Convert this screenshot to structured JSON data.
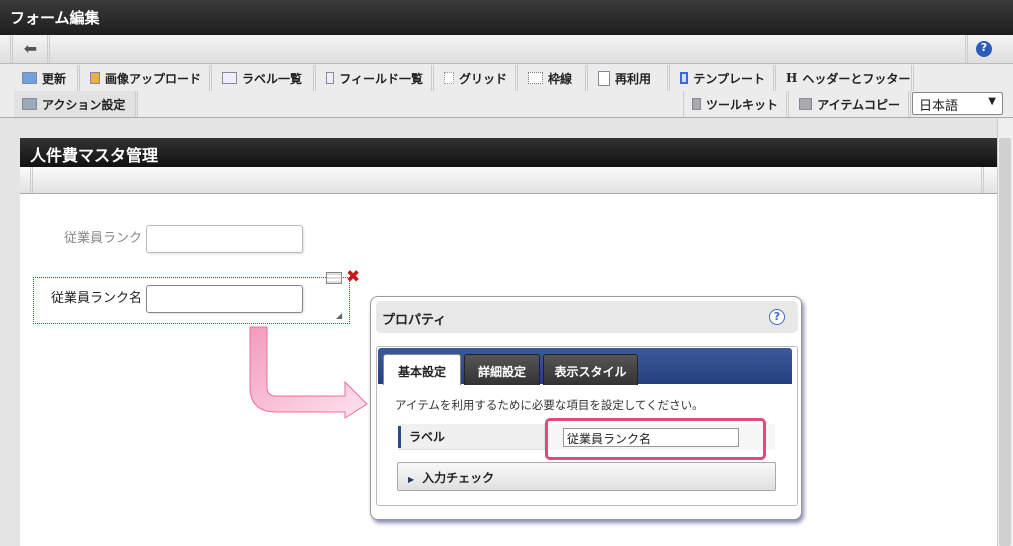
{
  "window": {
    "title": "フォーム編集"
  },
  "toolbar": {
    "back": "back",
    "help": "?",
    "items": [
      "更新",
      "画像アップロード",
      "ラベル一覧",
      "フィールド一覧",
      "グリッド",
      "枠線",
      "再利用",
      "テンプレート",
      "ヘッダーとフッター"
    ],
    "row2_left": "アクション設定",
    "toolkit": "ツールキット",
    "item_copy": "アイテムコピー",
    "language": "日本語",
    "header_footer_glyph": "H"
  },
  "form": {
    "title": "人件費マスタ管理",
    "fields": [
      {
        "label": "従業員ランク",
        "value": ""
      },
      {
        "label": "従業員ランク名",
        "value": ""
      }
    ]
  },
  "popup": {
    "title": "プロパティ",
    "help": "?",
    "tabs": [
      "基本設定",
      "詳細設定",
      "表示スタイル"
    ],
    "description": "アイテムを利用するために必要な項目を設定してください。",
    "label_name": "ラベル",
    "label_value": "従業員ランク名",
    "accordion": "入力チェック"
  },
  "colors": {
    "highlight": "#e8467f",
    "arrow": "#f2a6c3",
    "tab_blue": "#2d4a8a"
  }
}
